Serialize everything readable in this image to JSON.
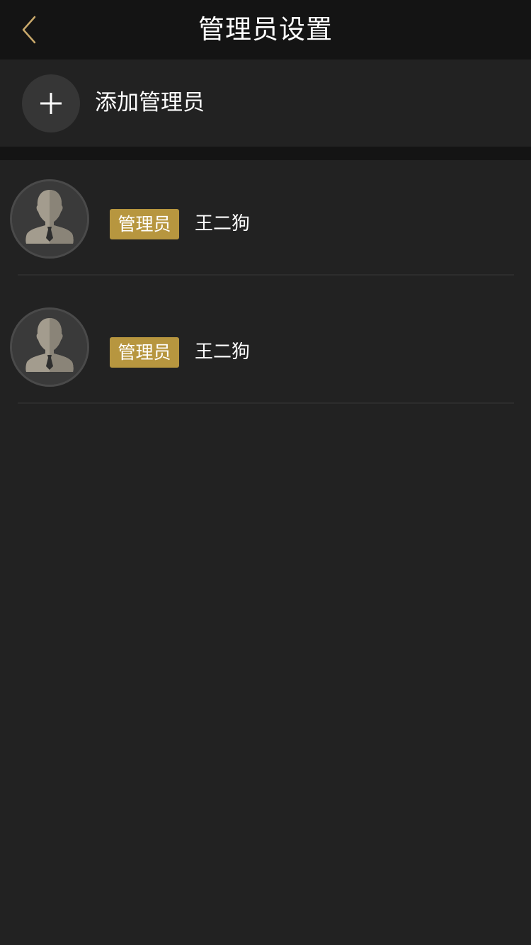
{
  "header": {
    "title": "管理员设置",
    "back_icon": "chevron-left-icon"
  },
  "add_admin": {
    "label": "添加管理员",
    "icon": "plus-icon"
  },
  "admins": [
    {
      "role": "管理员",
      "name": "王二狗",
      "avatar": "default-user-avatar"
    },
    {
      "role": "管理员",
      "name": "王二狗",
      "avatar": "default-user-avatar"
    }
  ],
  "colors": {
    "accent": "#b7963f",
    "nav_background": "#141414",
    "page_background": "#222222",
    "back_icon": "#c9a96b"
  }
}
